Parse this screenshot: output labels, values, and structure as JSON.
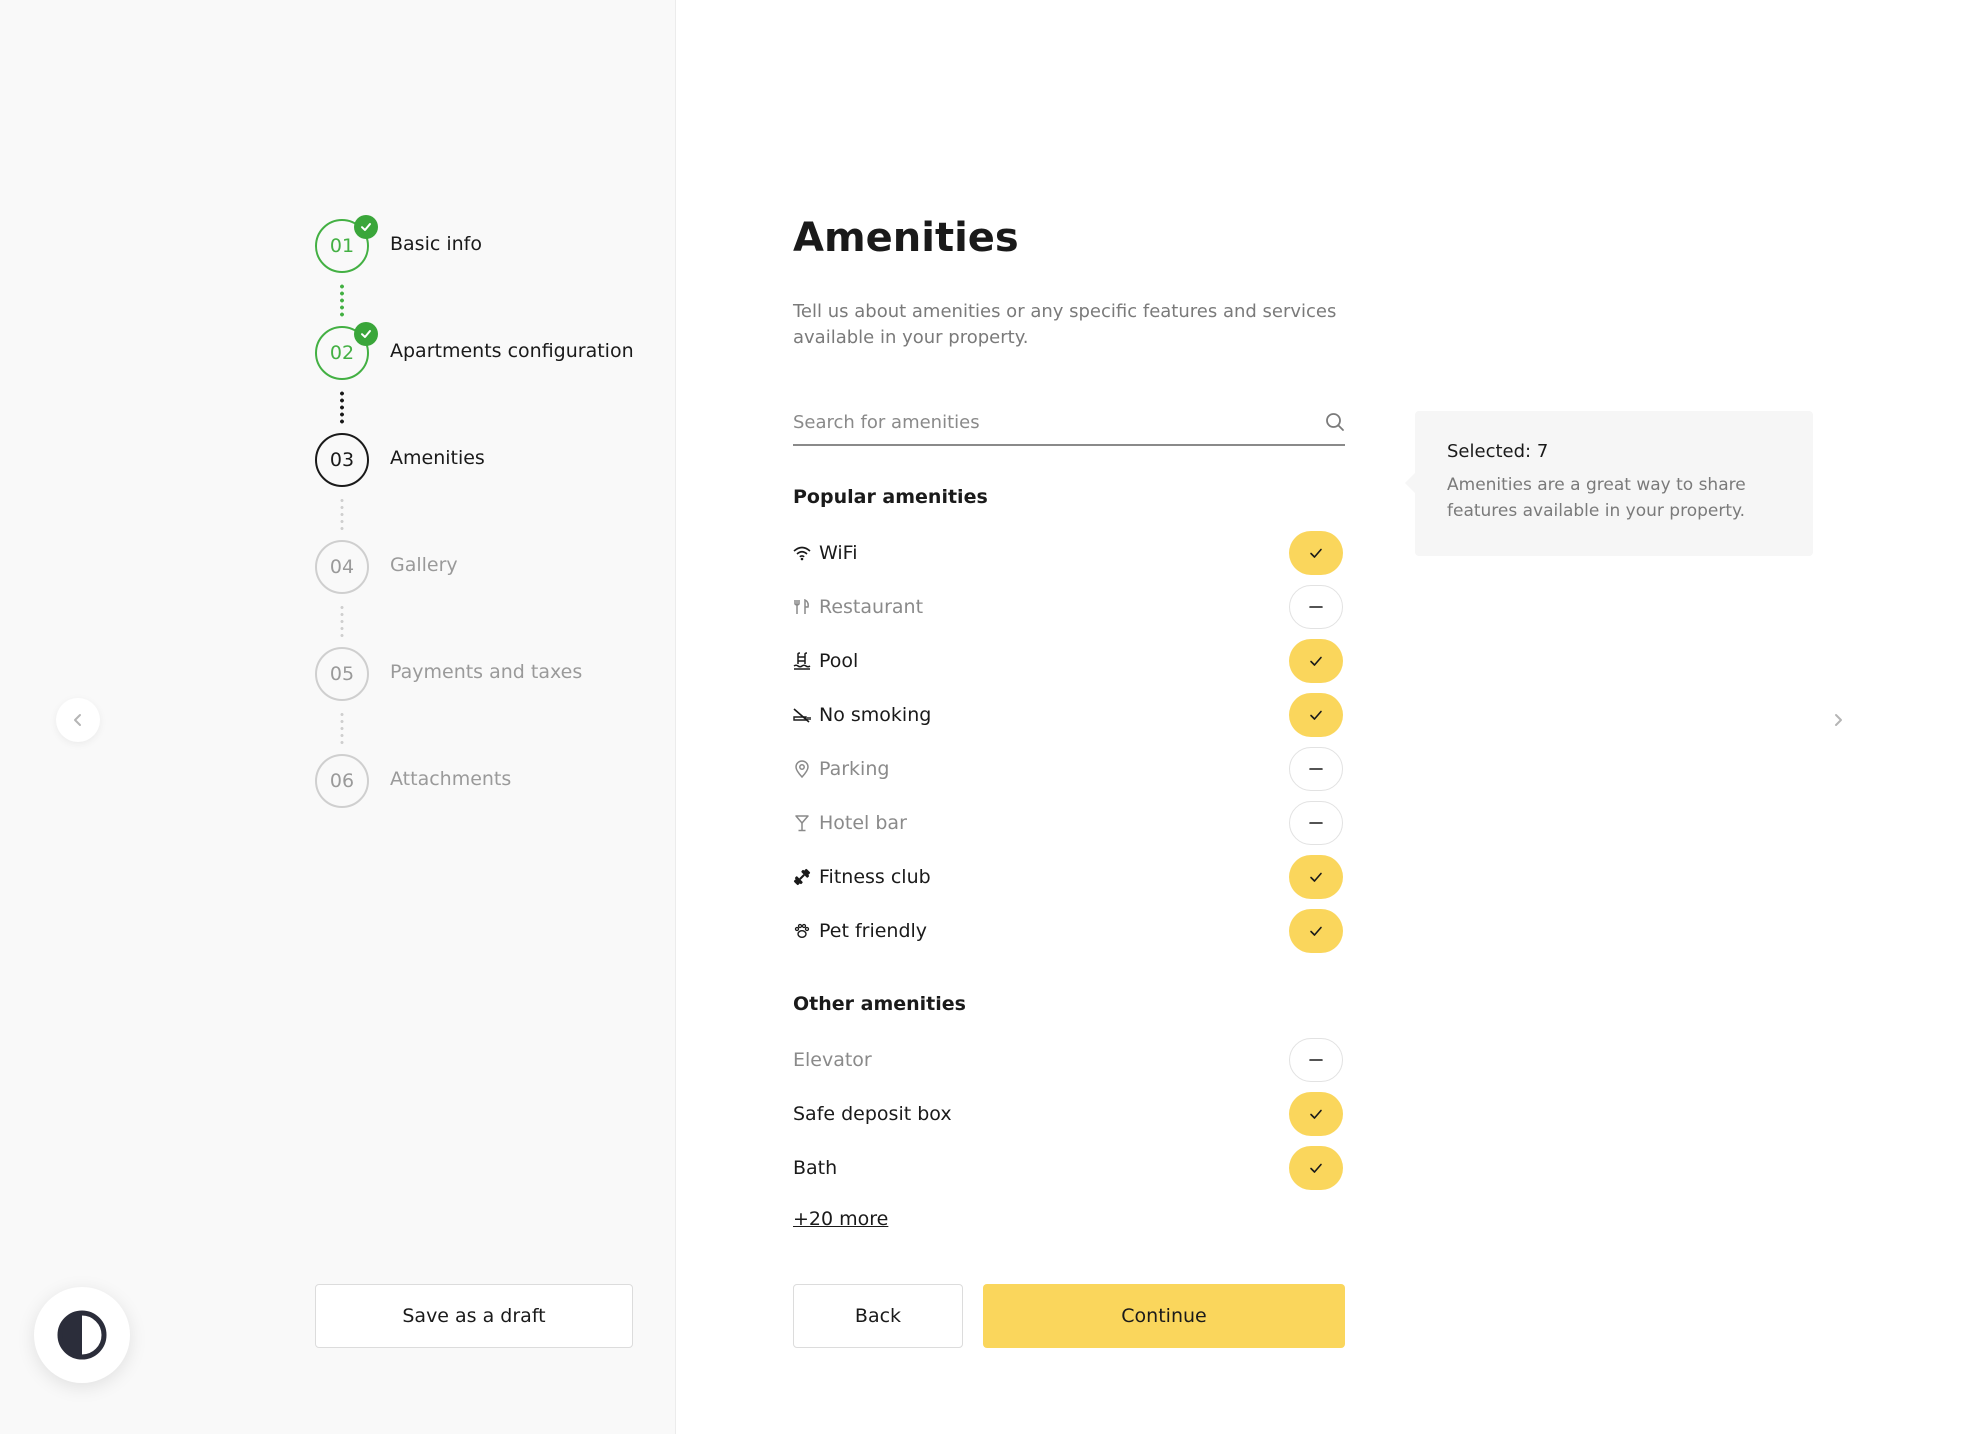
{
  "steps": [
    {
      "num": "01",
      "label": "Basic info",
      "state": "done"
    },
    {
      "num": "02",
      "label": "Apartments configuration",
      "state": "done"
    },
    {
      "num": "03",
      "label": "Amenities",
      "state": "active"
    },
    {
      "num": "04",
      "label": "Gallery",
      "state": "pending"
    },
    {
      "num": "05",
      "label": "Payments and taxes",
      "state": "pending"
    },
    {
      "num": "06",
      "label": "Attachments",
      "state": "pending"
    }
  ],
  "sidebar": {
    "draft_label": "Save as a draft"
  },
  "main": {
    "title": "Amenities",
    "subtitle": "Tell us about amenities or any specific features and services available in your property.",
    "search_placeholder": "Search for amenities",
    "popular_title": "Popular amenities",
    "popular": [
      {
        "label": "WiFi",
        "icon": "wifi-icon",
        "selected": true
      },
      {
        "label": "Restaurant",
        "icon": "utensils-icon",
        "selected": false
      },
      {
        "label": "Pool",
        "icon": "pool-icon",
        "selected": true
      },
      {
        "label": "No smoking",
        "icon": "no-smoking-icon",
        "selected": true
      },
      {
        "label": "Parking",
        "icon": "location-pin-icon",
        "selected": false
      },
      {
        "label": "Hotel bar",
        "icon": "cocktail-icon",
        "selected": false
      },
      {
        "label": "Fitness club",
        "icon": "dumbbell-icon",
        "selected": true
      },
      {
        "label": "Pet friendly",
        "icon": "paw-icon",
        "selected": true
      }
    ],
    "other_title": "Other amenities",
    "other": [
      {
        "label": "Elevator",
        "selected": false
      },
      {
        "label": "Safe deposit box",
        "selected": true
      },
      {
        "label": "Bath",
        "selected": true
      }
    ],
    "more_label": "+20 more",
    "back_label": "Back",
    "continue_label": "Continue"
  },
  "info": {
    "title": "Selected: 7",
    "text": "Amenities are a great way to share features available in your property."
  },
  "colors": {
    "accent": "#fad65c",
    "done": "#43b043"
  }
}
